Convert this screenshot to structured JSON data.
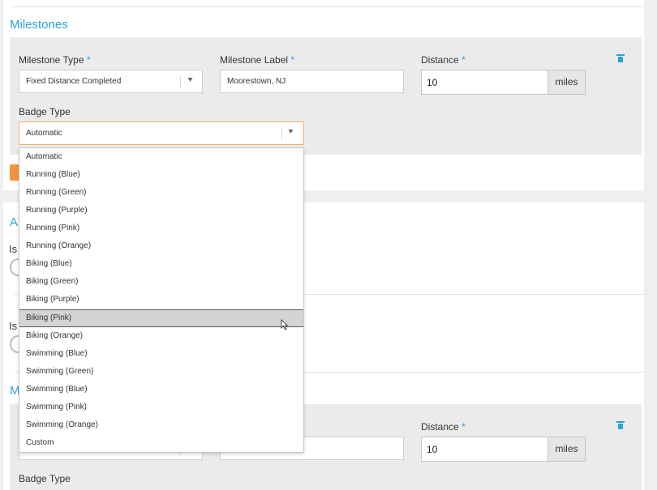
{
  "milestones_section": {
    "title": "Milestones"
  },
  "milestone_1": {
    "type_label": "Milestone Type",
    "type_value": "Fixed Distance Completed",
    "label_label": "Milestone Label",
    "label_value": "Moorestown, NJ",
    "distance_label": "Distance",
    "distance_value": "10",
    "distance_unit": "miles",
    "badge_label": "Badge Type",
    "badge_value": "Automatic",
    "required_mark": "*"
  },
  "milestone_2": {
    "distance_label": "Distance",
    "distance_value": "10",
    "distance_unit": "miles",
    "badge_label": "Badge Type",
    "required_mark": "*"
  },
  "partial_text": {
    "a_heading": "A",
    "is_1": "Is",
    "is_2": "Is",
    "m_heading": "M"
  },
  "badge_dropdown": {
    "options": [
      "Automatic",
      "Running (Blue)",
      "Running (Green)",
      "Running (Purple)",
      "Running (Pink)",
      "Running (Orange)",
      "Biking (Blue)",
      "Biking (Green)",
      "Biking (Purple)",
      "Biking (Pink)",
      "Biking (Orange)",
      "Swimming (Blue)",
      "Swimming (Green)",
      "Swimming (Blue)",
      "Swimming (Pink)",
      "Swimming (Orange)",
      "Custom"
    ],
    "highlighted": "Biking (Pink)"
  },
  "colors": {
    "accent_blue": "#29a3db",
    "accent_orange": "#f4933b"
  },
  "icons": {
    "caret": "▾",
    "trash": "trash-icon"
  }
}
